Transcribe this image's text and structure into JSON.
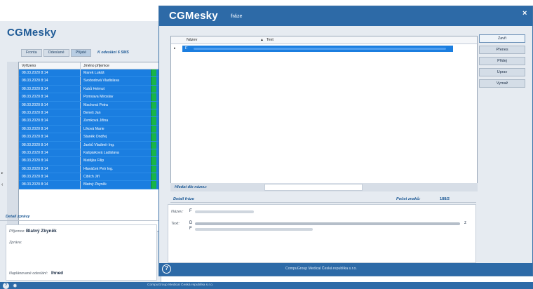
{
  "background_window": {
    "app_title": "CGMesky",
    "tabs": [
      "Fronta",
      "Odeslané",
      "Přijaté"
    ],
    "tab_note": "K odeslání 6 SMS",
    "grid": {
      "columns": [
        "Vyřízeno",
        "Jméno příjemce"
      ],
      "rows": [
        [
          "08.03.2020 8:14",
          "Marek Lukáš"
        ],
        [
          "08.03.2020 8:14",
          "Svobodová Vladislava"
        ],
        [
          "08.03.2020 8:14",
          "Kubů Helmut"
        ],
        [
          "08.03.2020 8:14",
          "Pomxava Miroslav"
        ],
        [
          "08.03.2020 8:14",
          "Machová Petra"
        ],
        [
          "08.03.2020 8:14",
          "Beneš Jan"
        ],
        [
          "08.03.2020 8:14",
          "Zemková Jiřina"
        ],
        [
          "08.03.2020 8:14",
          "Líková Marie"
        ],
        [
          "08.03.2020 8:14",
          "Staněk Ondřej"
        ],
        [
          "08.03.2020 8:14",
          "Janků Vladimír Ing."
        ],
        [
          "08.03.2020 8:14",
          "Kašpárková Ladislava"
        ],
        [
          "08.03.2020 8:14",
          "Matějka Filip"
        ],
        [
          "08.03.2020 8:14",
          "Hlaváček Petr Ing."
        ],
        [
          "08.03.2020 8:14",
          "Cibích Jiří"
        ],
        [
          "08.03.2020 8:14",
          "Blatný Zbyněk"
        ]
      ]
    },
    "detail": {
      "title": "Detail zprávy",
      "recipient_label": "Příjemce:",
      "recipient_value": "Blatný Zbyněk",
      "message_label": "Zpráva:",
      "scheduled_label": "Naplánované odeslání:",
      "scheduled_value": "Ihned"
    },
    "status_text": "CompuGroup Medical Česká republika s.r.o."
  },
  "dialog": {
    "title": "CGMesky",
    "subtitle": "fráze",
    "close_label": "×",
    "list": {
      "col_name": "Název",
      "col_sort": "▲",
      "col_text": "Text",
      "selected_row_name": "F"
    },
    "buttons": {
      "close": "Zavři",
      "move": "Přenes",
      "add": "Přidej",
      "edit": "Uprav",
      "delete": "Vymaž"
    },
    "search": {
      "label": "Hledat dle názvu:",
      "value": ""
    },
    "detail": {
      "title": "Detail fráze",
      "count_label": "Počet znaků:",
      "count_value": "188/2",
      "name_label": "Název:",
      "name_value": "F",
      "text_label": "Text:",
      "text_start": "D",
      "text_second_line": "F",
      "text_end": "z"
    },
    "footer_text": "CompuGroup Medical Česká republika s.r.o.",
    "help_label": "?"
  },
  "colors": {
    "accent": "#2d6aa7",
    "selection": "#1b7ee0",
    "status_green": "#18b44a"
  },
  "icons": {
    "help": "help-circle-icon",
    "settings": "gear-icon",
    "close": "close-icon"
  }
}
